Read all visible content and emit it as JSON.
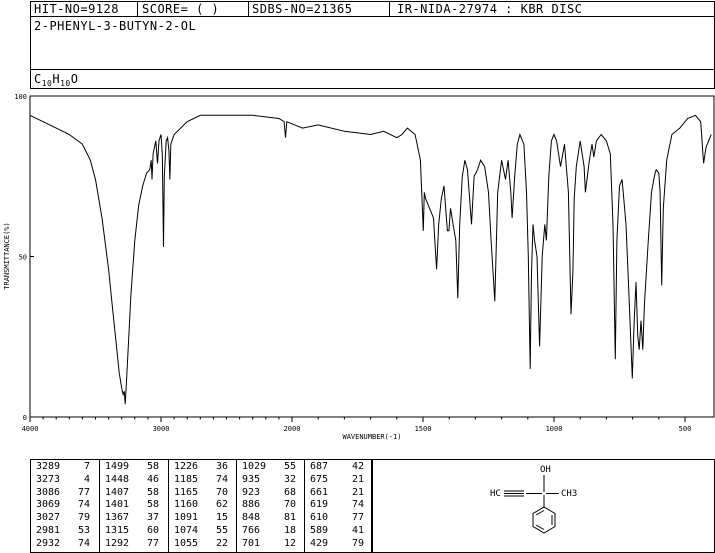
{
  "header": {
    "hit_no": "HIT-NO=9128",
    "score": "SCORE=  (   )",
    "sdbs_no": "SDBS-NO=21365",
    "ir_id": "IR-NIDA-27974 : KBR DISC",
    "compound_name": "2-PHENYL-3-BUTYN-2-OL",
    "formula_c": "C",
    "formula_c_sub": "10",
    "formula_h": "H",
    "formula_h_sub": "10",
    "formula_o": "O"
  },
  "chart_data": {
    "type": "line",
    "xlabel": "WAVENUMBER(-1)",
    "ylabel": "TRANSMITTANCE(%)",
    "xlim": [
      4000,
      400
    ],
    "ylim": [
      0,
      100
    ],
    "x_ticks": [
      {
        "value": 4000,
        "label": "4000"
      },
      {
        "value": 3000,
        "label": "3000"
      },
      {
        "value": 2000,
        "label": "2000"
      },
      {
        "value": 1500,
        "label": "1500"
      },
      {
        "value": 1000,
        "label": "1000"
      },
      {
        "value": 500,
        "label": "500"
      }
    ],
    "y_ticks": [
      {
        "value": 100,
        "label": "100"
      },
      {
        "value": 50,
        "label": "50"
      },
      {
        "value": 0,
        "label": "0"
      }
    ],
    "series": [
      {
        "points": [
          [
            4000,
            94
          ],
          [
            3900,
            92
          ],
          [
            3800,
            90
          ],
          [
            3700,
            88
          ],
          [
            3600,
            85
          ],
          [
            3540,
            80
          ],
          [
            3500,
            74
          ],
          [
            3450,
            62
          ],
          [
            3400,
            46
          ],
          [
            3370,
            34
          ],
          [
            3340,
            22
          ],
          [
            3320,
            14
          ],
          [
            3300,
            9
          ],
          [
            3289,
            7
          ],
          [
            3280,
            8
          ],
          [
            3273,
            4
          ],
          [
            3265,
            10
          ],
          [
            3250,
            22
          ],
          [
            3230,
            38
          ],
          [
            3200,
            55
          ],
          [
            3170,
            66
          ],
          [
            3140,
            72
          ],
          [
            3110,
            76
          ],
          [
            3086,
            77
          ],
          [
            3075,
            80
          ],
          [
            3069,
            74
          ],
          [
            3060,
            82
          ],
          [
            3040,
            86
          ],
          [
            3027,
            79
          ],
          [
            3015,
            86
          ],
          [
            3000,
            88
          ],
          [
            2990,
            82
          ],
          [
            2981,
            53
          ],
          [
            2975,
            75
          ],
          [
            2960,
            86
          ],
          [
            2950,
            87
          ],
          [
            2940,
            83
          ],
          [
            2932,
            74
          ],
          [
            2925,
            85
          ],
          [
            2900,
            88
          ],
          [
            2800,
            92
          ],
          [
            2700,
            94
          ],
          [
            2500,
            94
          ],
          [
            2300,
            94
          ],
          [
            2100,
            93
          ],
          [
            2060,
            92
          ],
          [
            2050,
            87
          ],
          [
            2040,
            92
          ],
          [
            1960,
            90
          ],
          [
            1900,
            91
          ],
          [
            1800,
            89
          ],
          [
            1700,
            88
          ],
          [
            1650,
            89
          ],
          [
            1600,
            87
          ],
          [
            1580,
            88
          ],
          [
            1560,
            90
          ],
          [
            1530,
            88
          ],
          [
            1510,
            80
          ],
          [
            1499,
            58
          ],
          [
            1495,
            70
          ],
          [
            1490,
            68
          ],
          [
            1470,
            64
          ],
          [
            1460,
            62
          ],
          [
            1455,
            55
          ],
          [
            1448,
            46
          ],
          [
            1440,
            60
          ],
          [
            1430,
            68
          ],
          [
            1420,
            72
          ],
          [
            1407,
            58
          ],
          [
            1401,
            58
          ],
          [
            1395,
            65
          ],
          [
            1385,
            60
          ],
          [
            1375,
            55
          ],
          [
            1367,
            37
          ],
          [
            1360,
            60
          ],
          [
            1350,
            75
          ],
          [
            1340,
            80
          ],
          [
            1330,
            77
          ],
          [
            1315,
            60
          ],
          [
            1305,
            75
          ],
          [
            1292,
            77
          ],
          [
            1280,
            80
          ],
          [
            1265,
            78
          ],
          [
            1250,
            70
          ],
          [
            1240,
            55
          ],
          [
            1226,
            36
          ],
          [
            1215,
            70
          ],
          [
            1200,
            80
          ],
          [
            1185,
            74
          ],
          [
            1175,
            80
          ],
          [
            1165,
            70
          ],
          [
            1160,
            62
          ],
          [
            1150,
            75
          ],
          [
            1140,
            85
          ],
          [
            1130,
            88
          ],
          [
            1115,
            85
          ],
          [
            1105,
            70
          ],
          [
            1098,
            50
          ],
          [
            1091,
            15
          ],
          [
            1086,
            45
          ],
          [
            1080,
            60
          ],
          [
            1074,
            55
          ],
          [
            1065,
            50
          ],
          [
            1055,
            22
          ],
          [
            1045,
            50
          ],
          [
            1035,
            60
          ],
          [
            1029,
            55
          ],
          [
            1020,
            75
          ],
          [
            1010,
            86
          ],
          [
            1000,
            88
          ],
          [
            990,
            86
          ],
          [
            975,
            78
          ],
          [
            960,
            85
          ],
          [
            945,
            70
          ],
          [
            935,
            32
          ],
          [
            928,
            45
          ],
          [
            923,
            68
          ],
          [
            915,
            78
          ],
          [
            900,
            86
          ],
          [
            885,
            78
          ],
          [
            880,
            70
          ],
          [
            865,
            80
          ],
          [
            855,
            85
          ],
          [
            848,
            81
          ],
          [
            838,
            86
          ],
          [
            820,
            88
          ],
          [
            800,
            86
          ],
          [
            785,
            82
          ],
          [
            775,
            60
          ],
          [
            766,
            18
          ],
          [
            760,
            55
          ],
          [
            750,
            72
          ],
          [
            740,
            74
          ],
          [
            725,
            60
          ],
          [
            715,
            40
          ],
          [
            701,
            12
          ],
          [
            694,
            30
          ],
          [
            687,
            42
          ],
          [
            680,
            25
          ],
          [
            675,
            21
          ],
          [
            668,
            30
          ],
          [
            661,
            21
          ],
          [
            655,
            35
          ],
          [
            640,
            55
          ],
          [
            628,
            70
          ],
          [
            619,
            74
          ],
          [
            614,
            76
          ],
          [
            610,
            77
          ],
          [
            600,
            76
          ],
          [
            595,
            70
          ],
          [
            589,
            41
          ],
          [
            583,
            65
          ],
          [
            570,
            80
          ],
          [
            550,
            88
          ],
          [
            520,
            90
          ],
          [
            490,
            93
          ],
          [
            460,
            94
          ],
          [
            440,
            92
          ],
          [
            429,
            79
          ],
          [
            420,
            84
          ],
          [
            410,
            86
          ],
          [
            400,
            88
          ]
        ]
      }
    ]
  },
  "peaks": [
    [
      {
        "wn": "3289",
        "t": "7"
      },
      {
        "wn": "3273",
        "t": "4"
      },
      {
        "wn": "3086",
        "t": "77"
      },
      {
        "wn": "3069",
        "t": "74"
      },
      {
        "wn": "3027",
        "t": "79"
      },
      {
        "wn": "2981",
        "t": "53"
      },
      {
        "wn": "2932",
        "t": "74"
      }
    ],
    [
      {
        "wn": "1499",
        "t": "58"
      },
      {
        "wn": "1448",
        "t": "46"
      },
      {
        "wn": "1407",
        "t": "58"
      },
      {
        "wn": "1401",
        "t": "58"
      },
      {
        "wn": "1367",
        "t": "37"
      },
      {
        "wn": "1315",
        "t": "60"
      },
      {
        "wn": "1292",
        "t": "77"
      }
    ],
    [
      {
        "wn": "1226",
        "t": "36"
      },
      {
        "wn": "1185",
        "t": "74"
      },
      {
        "wn": "1165",
        "t": "70"
      },
      {
        "wn": "1160",
        "t": "62"
      },
      {
        "wn": "1091",
        "t": "15"
      },
      {
        "wn": "1074",
        "t": "55"
      },
      {
        "wn": "1055",
        "t": "22"
      }
    ],
    [
      {
        "wn": "1029",
        "t": "55"
      },
      {
        "wn": "935",
        "t": "32"
      },
      {
        "wn": "923",
        "t": "68"
      },
      {
        "wn": "886",
        "t": "70"
      },
      {
        "wn": "848",
        "t": "81"
      },
      {
        "wn": "766",
        "t": "18"
      },
      {
        "wn": "701",
        "t": "12"
      }
    ],
    [
      {
        "wn": "687",
        "t": "42"
      },
      {
        "wn": "675",
        "t": "21"
      },
      {
        "wn": "661",
        "t": "21"
      },
      {
        "wn": "619",
        "t": "74"
      },
      {
        "wn": "610",
        "t": "77"
      },
      {
        "wn": "589",
        "t": "41"
      },
      {
        "wn": "429",
        "t": "79"
      }
    ]
  ],
  "structure": {
    "oh_label": "OH",
    "h_label": "HC",
    "c_left": "C",
    "c_center": "C",
    "ch3_label": "CH3"
  }
}
